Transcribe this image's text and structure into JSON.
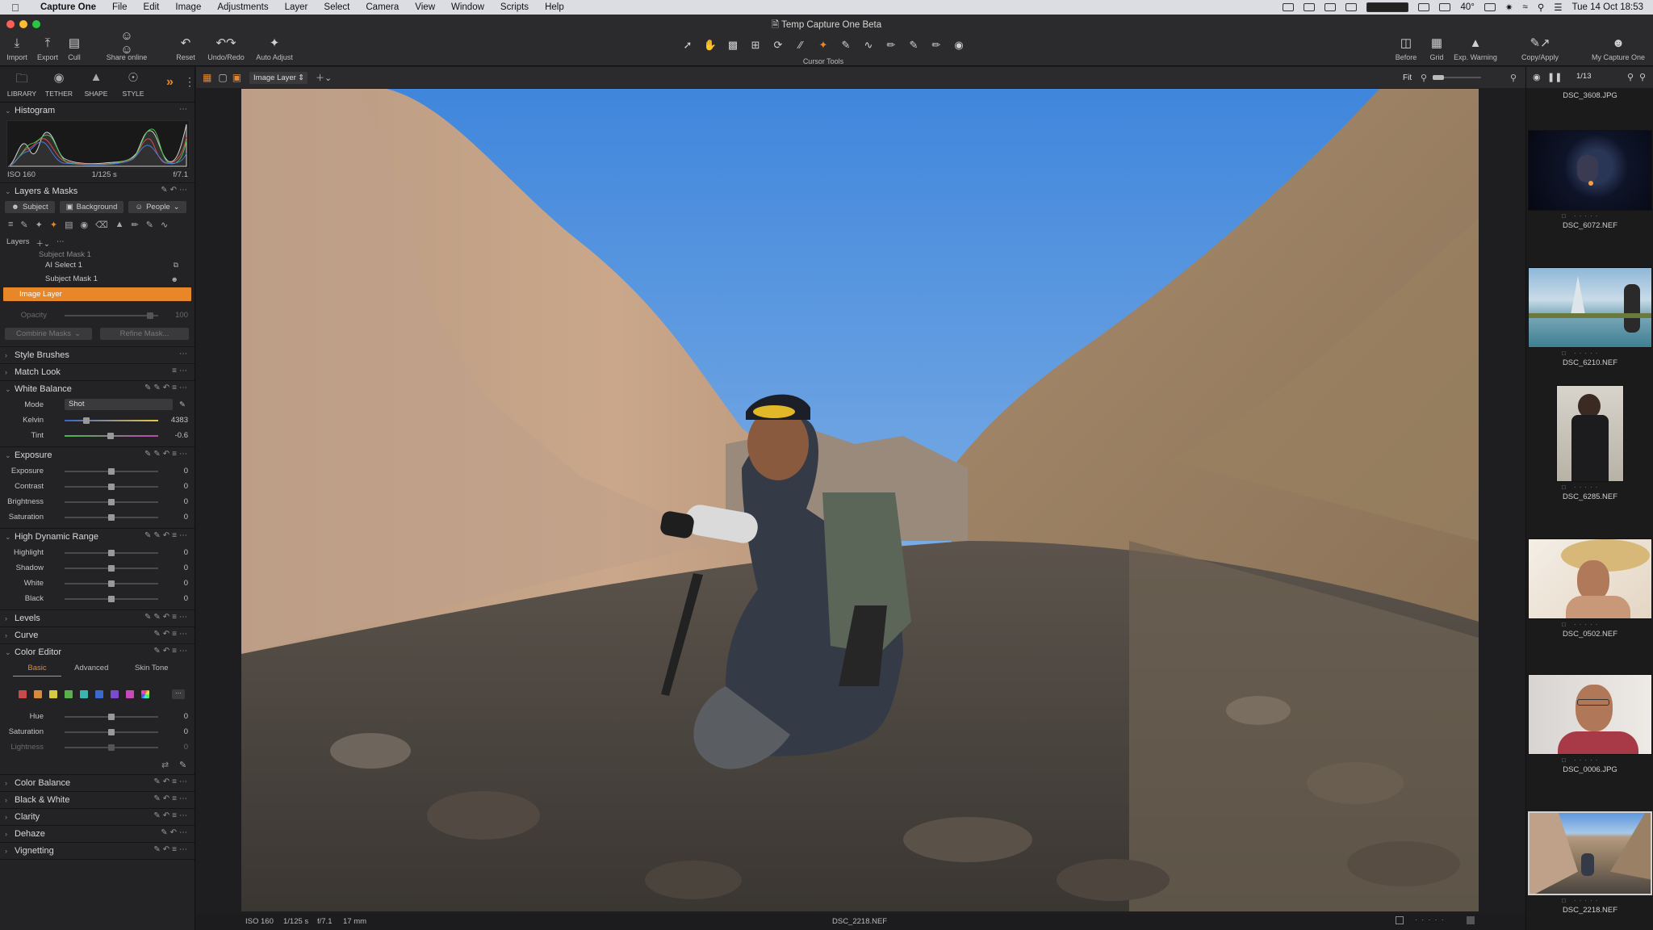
{
  "menubar": {
    "app_name": "Capture One",
    "menus": [
      "File",
      "Edit",
      "Image",
      "Adjustments",
      "Layer",
      "Select",
      "Camera",
      "View",
      "Window",
      "Scripts",
      "Help"
    ],
    "temperature": "40°",
    "clock": "Tue 14 Oct  18:53"
  },
  "window": {
    "title": "Temp Capture One Beta"
  },
  "toolbar": {
    "import": "Import",
    "export": "Export",
    "cull": "Cull",
    "share": "Share online",
    "reset": "Reset",
    "undo_redo": "Undo/Redo",
    "auto_adjust": "Auto Adjust",
    "cursor_tools": "Cursor Tools",
    "before": "Before",
    "grid": "Grid",
    "exp_warning": "Exp. Warning",
    "copy_apply": "Copy/Apply",
    "my_capture_one": "My Capture One"
  },
  "tool_tabs": {
    "library": "LIBRARY",
    "tether": "TETHER",
    "shape": "SHAPE",
    "style": "STYLE"
  },
  "histogram": {
    "title": "Histogram",
    "iso": "ISO 160",
    "shutter": "1/125 s",
    "aperture": "f/7.1"
  },
  "layers_masks": {
    "title": "Layers & Masks",
    "buttons": [
      "Subject",
      "Background",
      "People"
    ],
    "layers_label": "Layers",
    "rows": [
      "Subject Mask 1",
      "AI Select 1",
      "Subject Mask 1"
    ],
    "selected_layer": "Image Layer",
    "opacity_label": "Opacity",
    "opacity_value": "100",
    "combine": "Combine Masks",
    "refine": "Refine Mask..."
  },
  "tools": {
    "style_brushes": "Style Brushes",
    "match_look": "Match Look",
    "white_balance": "White Balance",
    "exposure": "Exposure",
    "hdr": "High Dynamic Range",
    "levels": "Levels",
    "curve": "Curve",
    "color_editor": "Color Editor",
    "color_balance": "Color Balance",
    "bw": "Black & White",
    "clarity": "Clarity",
    "dehaze": "Dehaze",
    "vignetting": "Vignetting"
  },
  "white_balance": {
    "mode_label": "Mode",
    "mode_value": "Shot",
    "kelvin_label": "Kelvin",
    "kelvin_value": "4383",
    "kelvin_level": 0.23,
    "tint_label": "Tint",
    "tint_value": "-0.6",
    "tint_level": 0.49
  },
  "exposure": [
    {
      "label": "Exposure",
      "value": "0"
    },
    {
      "label": "Contrast",
      "value": "0"
    },
    {
      "label": "Brightness",
      "value": "0"
    },
    {
      "label": "Saturation",
      "value": "0"
    }
  ],
  "hdr": [
    {
      "label": "Highlight",
      "value": "0"
    },
    {
      "label": "Shadow",
      "value": "0"
    },
    {
      "label": "White",
      "value": "0"
    },
    {
      "label": "Black",
      "value": "0"
    }
  ],
  "color_editor": {
    "tabs": [
      "Basic",
      "Advanced",
      "Skin Tone"
    ],
    "swatches": [
      "#c84a4a",
      "#d88a3a",
      "#d8c840",
      "#5ab04a",
      "#3ab4b0",
      "#3a6ad0",
      "#7a4ad0",
      "#c84ab8"
    ],
    "sliders": [
      {
        "label": "Hue",
        "value": "0"
      },
      {
        "label": "Saturation",
        "value": "0"
      },
      {
        "label": "Lightness",
        "value": "0"
      }
    ]
  },
  "viewer": {
    "layer_select": "Image Layer",
    "zoom": "Fit",
    "counter": "1/13"
  },
  "status": {
    "iso": "ISO 160",
    "shutter": "1/125 s",
    "aperture": "f/7.1",
    "focal": "17 mm",
    "filename": "DSC_2218.NEF"
  },
  "browser": {
    "files": [
      "DSC_3608.JPG",
      "DSC_6072.NEF",
      "DSC_6210.NEF",
      "DSC_6285.NEF",
      "DSC_0502.NEF",
      "DSC_0006.JPG",
      "DSC_2218.NEF"
    ]
  },
  "colors": {
    "accent": "#e8862a",
    "panel": "#232325",
    "sky_top": "#4a8fdd",
    "rock": "#b09077"
  }
}
